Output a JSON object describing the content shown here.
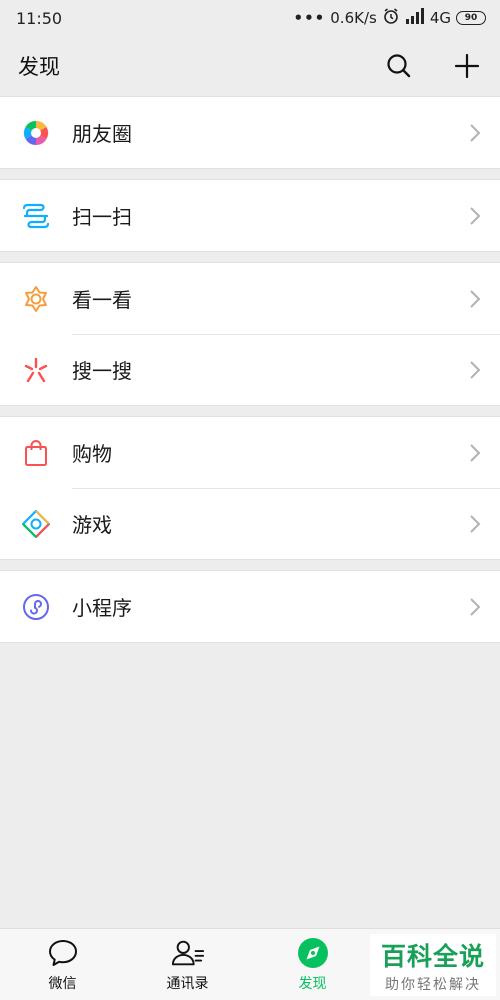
{
  "status_bar": {
    "time": "11:50",
    "dots": "•••",
    "speed": "0.6K/s",
    "network": "4G",
    "battery": "90"
  },
  "header": {
    "title": "发现",
    "actions": [
      "search-icon",
      "plus-icon"
    ]
  },
  "groups": [
    {
      "items": [
        {
          "label": "朋友圈",
          "icon": "moments-icon"
        }
      ]
    },
    {
      "items": [
        {
          "label": "扫一扫",
          "icon": "scan-icon"
        }
      ]
    },
    {
      "items": [
        {
          "label": "看一看",
          "icon": "top-stories-icon"
        },
        {
          "label": "搜一搜",
          "icon": "search-search-icon"
        }
      ]
    },
    {
      "items": [
        {
          "label": "购物",
          "icon": "shopping-bag-icon"
        },
        {
          "label": "游戏",
          "icon": "games-icon"
        }
      ]
    },
    {
      "items": [
        {
          "label": "小程序",
          "icon": "mini-program-icon"
        }
      ]
    }
  ],
  "tabbar": {
    "tabs": [
      {
        "label": "微信",
        "icon": "chat-bubble-icon"
      },
      {
        "label": "通讯录",
        "icon": "contacts-icon"
      },
      {
        "label": "发现",
        "icon": "compass-icon",
        "active": true
      }
    ]
  },
  "watermark": {
    "main": "百科全说",
    "sub": "助你轻松解决"
  },
  "colors": {
    "accent": "#07c160",
    "background": "#ededed"
  }
}
